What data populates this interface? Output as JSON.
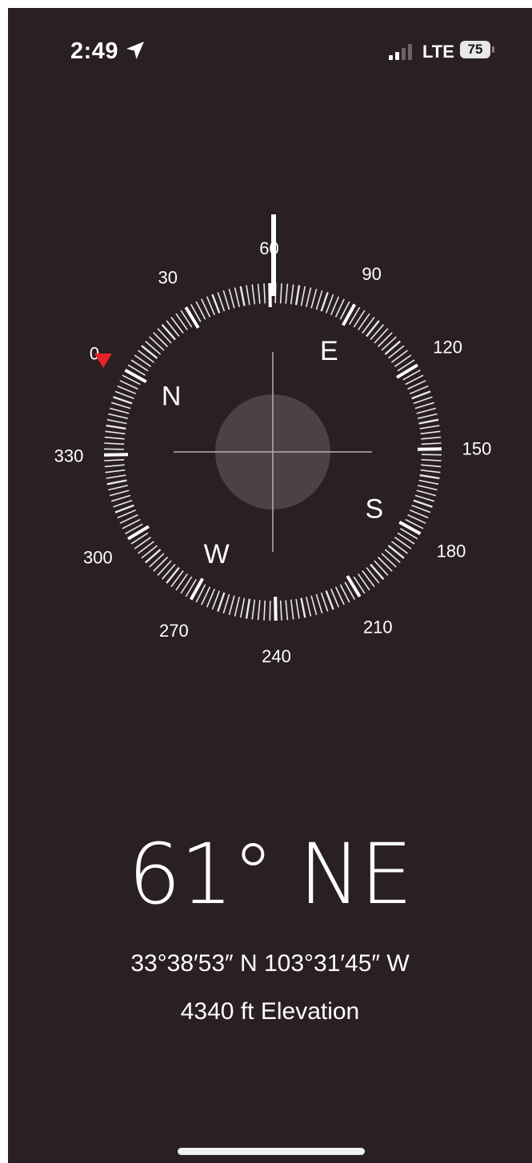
{
  "status_bar": {
    "time": "2:49",
    "location_icon": "location-arrow-icon",
    "signal_icon": "cellular-signal-icon",
    "network": "LTE",
    "battery": "75"
  },
  "compass": {
    "heading_degrees": 61,
    "degree_labels": [
      "0",
      "30",
      "60",
      "90",
      "120",
      "150",
      "180",
      "210",
      "240",
      "270",
      "300",
      "330"
    ],
    "cardinals": {
      "north": "N",
      "east": "E",
      "south": "S",
      "west": "W"
    },
    "colors": {
      "background": "#2a1f21",
      "north_marker": "#e8222b",
      "ticks": "#ffffff"
    }
  },
  "readout": {
    "heading": "61° NE",
    "coordinates": "33°38′53″ N  103°31′45″ W",
    "elevation": "4340 ft Elevation"
  }
}
